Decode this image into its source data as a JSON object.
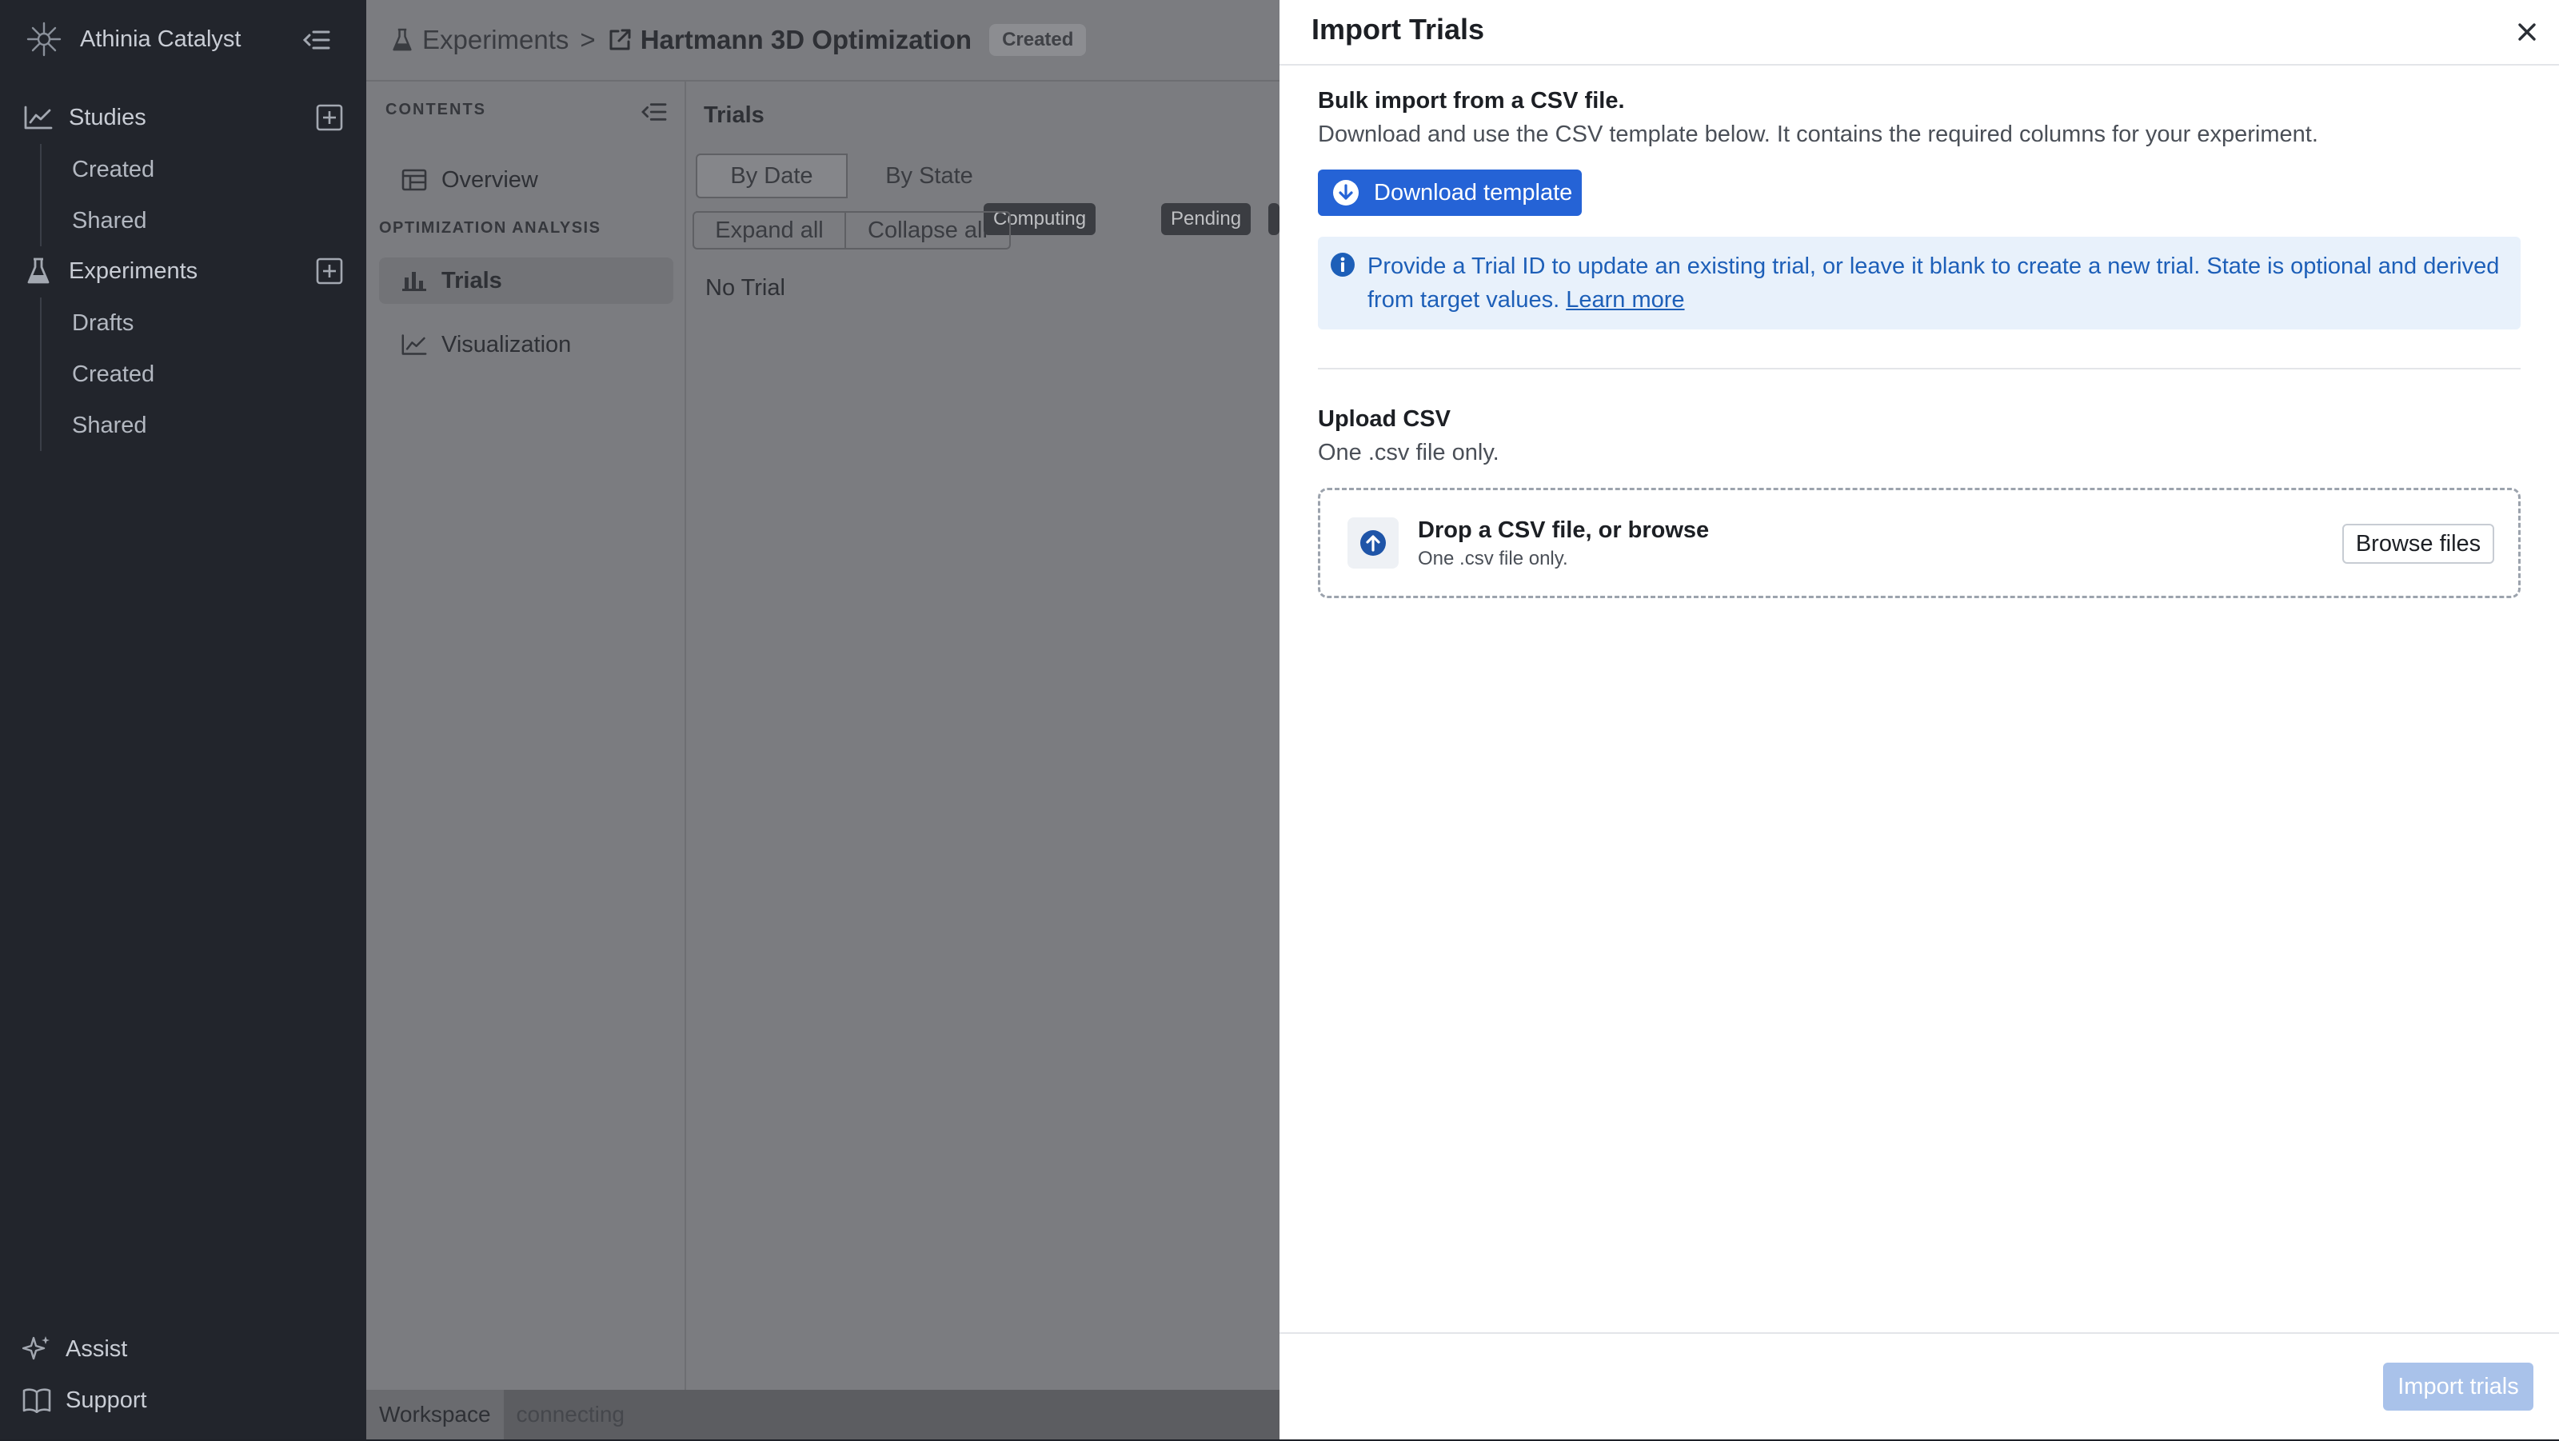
{
  "app": {
    "name": "Athinia Catalyst"
  },
  "sidebar": {
    "studies": {
      "label": "Studies",
      "items": [
        "Created",
        "Shared"
      ]
    },
    "experiments": {
      "label": "Experiments",
      "items": [
        "Drafts",
        "Created",
        "Shared"
      ]
    },
    "bottom": {
      "assist": "Assist",
      "support": "Support"
    }
  },
  "header": {
    "crumb_root": "Experiments",
    "crumb_sep": ">",
    "experiment_title": "Hartmann 3D Optimization",
    "status_badge": "Created"
  },
  "contents": {
    "heading": "CONTENTS",
    "overview": "Overview",
    "group_label": "OPTIMIZATION ANALYSIS",
    "trials": "Trials",
    "visualization": "Visualization"
  },
  "trials_panel": {
    "title": "Trials",
    "tabs": [
      "By Date",
      "By State"
    ],
    "expand_all": "Expand all",
    "collapse_all": "Collapse all",
    "chips": [
      "Computing",
      "Pending"
    ],
    "empty_text": "No Trial"
  },
  "statusbar": {
    "workspace": "Workspace",
    "state": "connecting"
  },
  "drawer": {
    "title": "Import Trials",
    "bulk_title": "Bulk import from a CSV file.",
    "bulk_desc": "Download and use the CSV template below. It contains the required columns for your experiment.",
    "download_btn": "Download template",
    "info_text": "Provide a Trial ID to update an existing trial, or leave it blank to create a new trial. State is optional and derived from target values.",
    "info_link": "Learn more",
    "upload_title": "Upload CSV",
    "upload_desc": "One .csv file only.",
    "dropzone_title": "Drop a CSV file, or browse",
    "dropzone_sub": "One .csv file only.",
    "browse_btn": "Browse files",
    "import_btn": "Import trials"
  },
  "colors": {
    "primary": "#2563d6",
    "info_bg": "#e8f1fb",
    "info_text": "#1d5fb8",
    "sidebar_bg": "#22252c",
    "overlay": "#7b7c80"
  }
}
